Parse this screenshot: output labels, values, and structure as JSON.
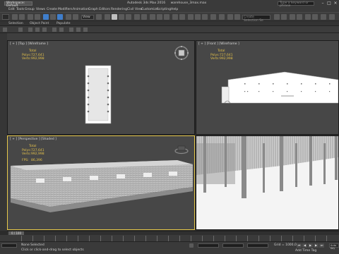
{
  "titlebar": {
    "workspace": "Workspace: Default",
    "app_title": "Autodesk 3ds Max 2016",
    "file_name": "warehouse_3max.max",
    "search_placeholder": "Type a keyword or phrase",
    "minimize": "–",
    "maximize": "□",
    "close": "×"
  },
  "menu": [
    "Edit",
    "Tools",
    "Group",
    "Views",
    "Create",
    "Modifiers",
    "Animation",
    "Graph Editors",
    "Rendering",
    "Civil View",
    "Customize",
    "Scripting",
    "Help"
  ],
  "toolbar": {
    "view_dropdown": "View",
    "named_selection_placeholder": "Create Selection Se"
  },
  "ribbon": {
    "tabs": [
      "Selection",
      "Object Paint",
      "Populate"
    ]
  },
  "viewports": {
    "top": {
      "label": "[ + ] [Top ] [Wireframe ]",
      "stats": {
        "title": "Total",
        "polys_label": "Polys:",
        "polys": "727,641",
        "verts_label": "Verts:",
        "verts": "992,998"
      }
    },
    "front": {
      "label": "[ + ] [Front ] [Wireframe ]",
      "stats": {
        "title": "Total",
        "polys_label": "Polys:",
        "polys": "727,641",
        "verts_label": "Verts:",
        "verts": "992,998"
      }
    },
    "perspective": {
      "label": "[ + ] [Perspective ] [Shaded ]",
      "stats": {
        "title": "Total",
        "polys_label": "Polys:",
        "polys": "727,641",
        "verts_label": "Verts:",
        "verts": "992,998",
        "fps_label": "FPS:",
        "fps": "86,396"
      }
    }
  },
  "timeline": {
    "frame_counter": "0 / 100"
  },
  "status": {
    "line1": "None Selected",
    "line2": "Click or click-and-drag to select objects",
    "grid": "Grid = 1000,0cm",
    "add_time_tag": "Add Time Tag",
    "auto_key": "Auto Key"
  },
  "colors": {
    "viewport_bg": "#474747",
    "active_border": "#e6c84a",
    "stats_text": "#e3c04a",
    "selection_blue": "#3f7ecb"
  }
}
